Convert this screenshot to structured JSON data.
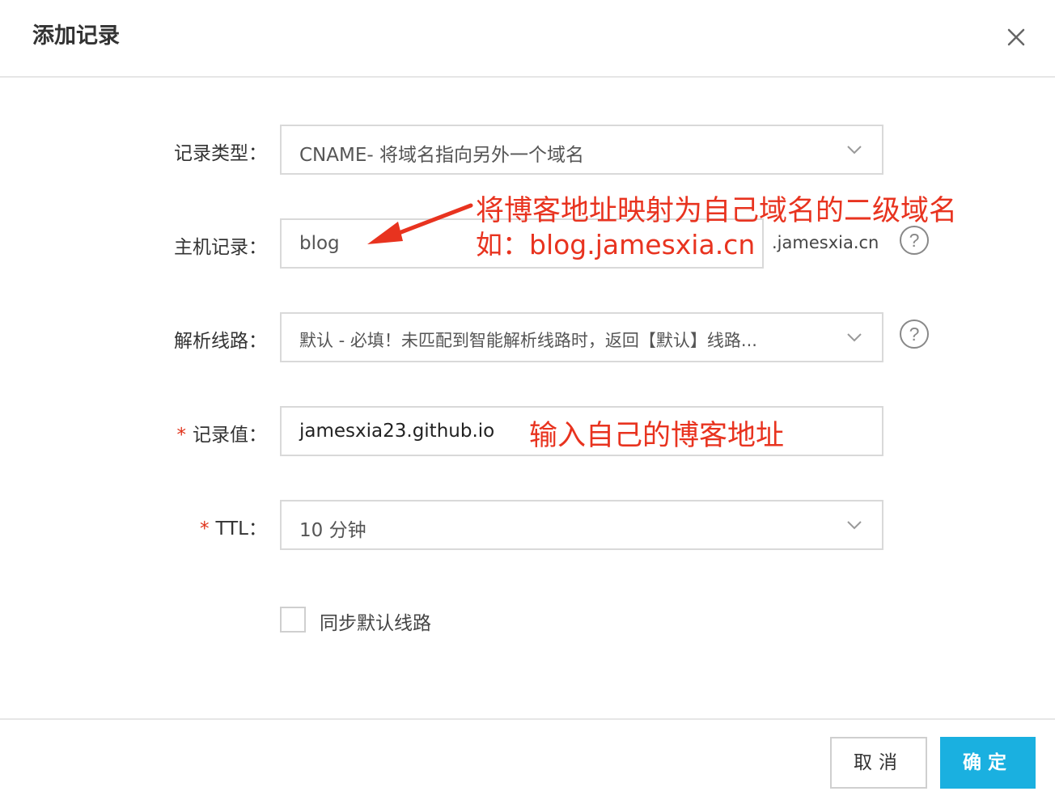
{
  "dialog": {
    "title": "添加记录"
  },
  "form": {
    "record_type": {
      "label": "记录类型：",
      "value": "CNAME- 将域名指向另外一个域名"
    },
    "host": {
      "label": "主机记录：",
      "value": "blog",
      "suffix": ".jamesxia.cn"
    },
    "line": {
      "label": "解析线路：",
      "value": "默认 - 必填！未匹配到智能解析线路时，返回【默认】线路..."
    },
    "record_value": {
      "required_mark": "*",
      "label": "记录值：",
      "value": "jamesxia23.github.io"
    },
    "ttl": {
      "required_mark": "*",
      "label": "TTL：",
      "value": "10 分钟"
    },
    "sync_default": {
      "label": "同步默认线路",
      "checked": false
    }
  },
  "annotations": {
    "host_line1": "将博客地址映射为自己域名的二级域名",
    "host_line2": "如：blog.jamesxia.cn",
    "value_note": "输入自己的博客地址",
    "color": "#e8331f"
  },
  "footer": {
    "cancel_label": "取消",
    "ok_label": "确定"
  },
  "colors": {
    "primary": "#1ab0e0",
    "required": "#e0321a"
  },
  "icons": [
    "close-icon",
    "chevron-down-icon",
    "help-icon",
    "arrow-annotation"
  ]
}
